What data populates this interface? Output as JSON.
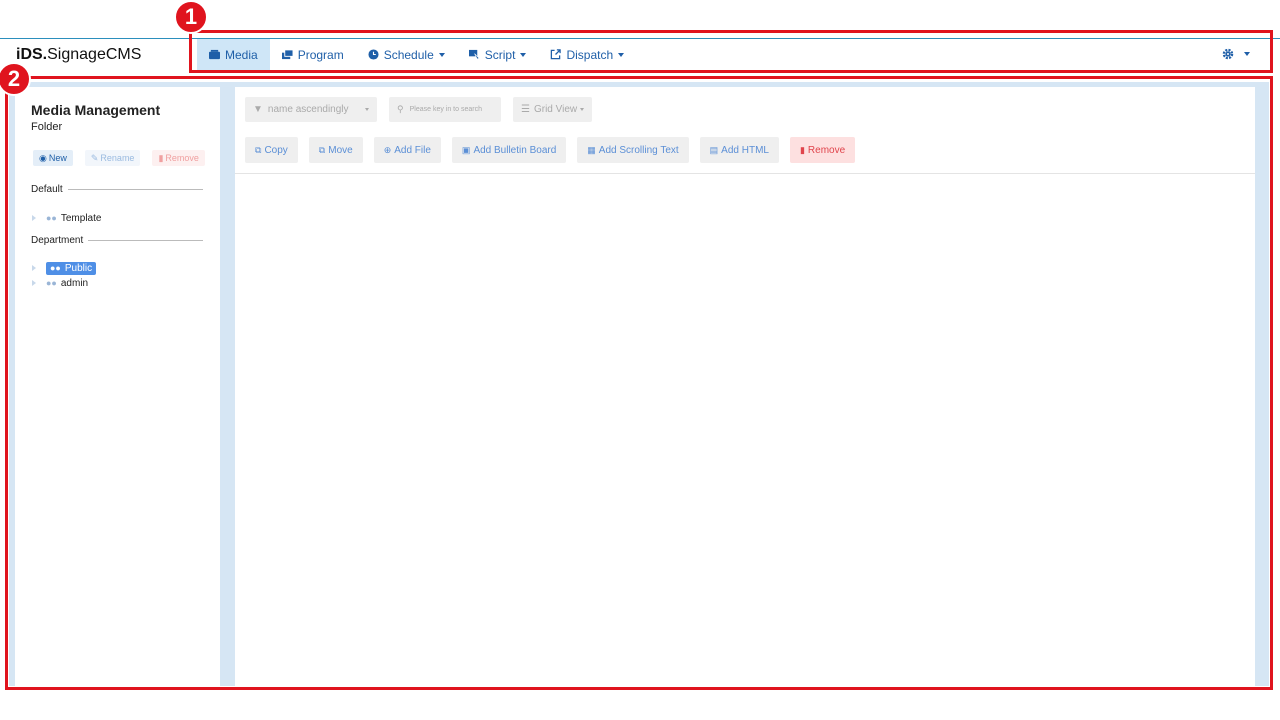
{
  "app": {
    "logo_bold": "iDS.",
    "logo_rest": "SignageCMS"
  },
  "nav": {
    "items": [
      {
        "label": "Media",
        "icon": "media-icon",
        "active": true,
        "dropdown": false
      },
      {
        "label": "Program",
        "icon": "program-icon",
        "active": false,
        "dropdown": false
      },
      {
        "label": "Schedule",
        "icon": "clock-icon",
        "active": false,
        "dropdown": true
      },
      {
        "label": "Script",
        "icon": "script-icon",
        "active": false,
        "dropdown": true
      },
      {
        "label": "Dispatch",
        "icon": "dispatch-icon",
        "active": false,
        "dropdown": true
      }
    ],
    "settings_icon": "gear-icon"
  },
  "annotations": {
    "box1": "1",
    "box2": "2"
  },
  "sidebar": {
    "title": "Media Management",
    "subtitle": "Folder",
    "buttons": {
      "new": "New",
      "rename": "Rename",
      "remove": "Remove"
    },
    "sections": [
      {
        "label": "Default",
        "items": [
          {
            "label": "Template",
            "selected": false
          }
        ]
      },
      {
        "label": "Department",
        "items": [
          {
            "label": "Public",
            "selected": true
          },
          {
            "label": "admin",
            "selected": false
          }
        ]
      }
    ]
  },
  "toolbar": {
    "sort_value": "name ascendingly",
    "search_placeholder": "Please key in to search",
    "view_value": "Grid View",
    "actions": {
      "copy": "Copy",
      "move": "Move",
      "add_file": "Add File",
      "add_bulletin": "Add Bulletin Board",
      "add_scrolling": "Add Scrolling Text",
      "add_html": "Add HTML",
      "remove": "Remove"
    }
  },
  "colors": {
    "accent": "#1f5fa8",
    "active_nav": "#cfe6f7",
    "selected": "#4f8fe6",
    "annotation": "#e0141e",
    "danger": "#e0444c"
  }
}
